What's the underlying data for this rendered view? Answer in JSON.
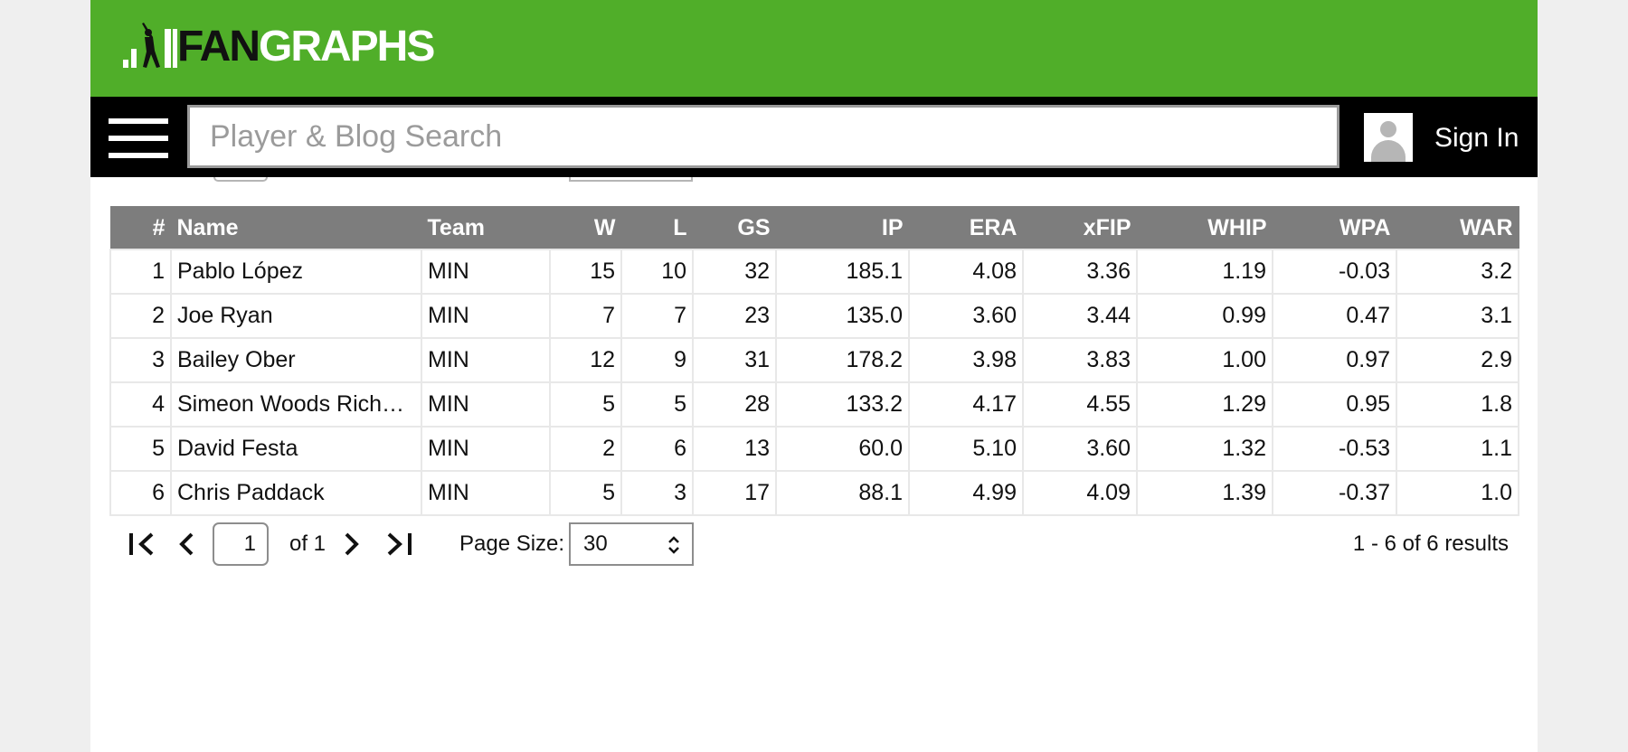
{
  "brand": {
    "fan": "FAN",
    "graphs": "GRAPHS",
    "colors": {
      "header": "#50ae29",
      "nav": "#000000"
    }
  },
  "nav": {
    "menu_icon": "hamburger-menu-icon",
    "search_placeholder": "Player & Blog Search",
    "user_icon": "user-avatar-icon",
    "signin_label": "Sign In"
  },
  "table": {
    "headers": [
      "#",
      "Name",
      "Team",
      "W",
      "L",
      "GS",
      "IP",
      "ERA",
      "xFIP",
      "WHIP",
      "WPA",
      "WAR"
    ],
    "rows": [
      [
        "1",
        "Pablo López",
        "MIN",
        "15",
        "10",
        "32",
        "185.1",
        "4.08",
        "3.36",
        "1.19",
        "-0.03",
        "3.2"
      ],
      [
        "2",
        "Joe Ryan",
        "MIN",
        "7",
        "7",
        "23",
        "135.0",
        "3.60",
        "3.44",
        "0.99",
        "0.47",
        "3.1"
      ],
      [
        "3",
        "Bailey Ober",
        "MIN",
        "12",
        "9",
        "31",
        "178.2",
        "3.98",
        "3.83",
        "1.00",
        "0.97",
        "2.9"
      ],
      [
        "4",
        "Simeon Woods Rich…",
        "MIN",
        "5",
        "5",
        "28",
        "133.2",
        "4.17",
        "4.55",
        "1.29",
        "0.95",
        "1.8"
      ],
      [
        "5",
        "David Festa",
        "MIN",
        "2",
        "6",
        "13",
        "60.0",
        "5.10",
        "3.60",
        "1.32",
        "-0.53",
        "1.1"
      ],
      [
        "6",
        "Chris Paddack",
        "MIN",
        "5",
        "3",
        "17",
        "88.1",
        "4.99",
        "4.09",
        "1.39",
        "-0.37",
        "1.0"
      ]
    ]
  },
  "pagination": {
    "first_icon": "first-page-icon",
    "prev_icon": "previous-page-icon",
    "next_icon": "next-page-icon",
    "last_icon": "last-page-icon",
    "current_page": "1",
    "of_label": "of 1",
    "page_size_label": "Page Size:",
    "page_size_value": "30",
    "results_label": "1 - 6 of 6 results"
  }
}
